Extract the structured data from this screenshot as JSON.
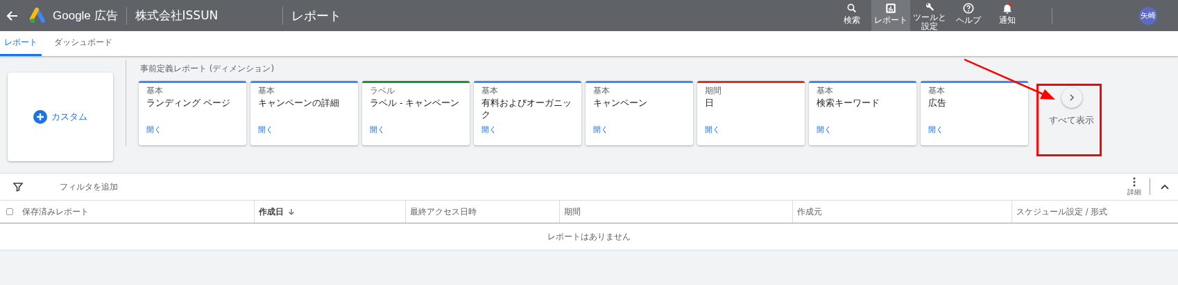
{
  "top_bar": {
    "product": "Google 広告",
    "account": "株式会社ISSUN",
    "page_title": "レポート",
    "nav": [
      {
        "label": "検索",
        "selected": false
      },
      {
        "label": "レポート",
        "selected": true
      },
      {
        "label": "ツールと設定",
        "selected": false
      },
      {
        "label": "ヘルプ",
        "selected": false
      },
      {
        "label": "通知",
        "selected": false
      }
    ],
    "avatar": "矢崎"
  },
  "tabs": [
    {
      "label": "レポート",
      "selected": true
    },
    {
      "label": "ダッシュボード",
      "selected": false
    }
  ],
  "custom_card": {
    "label": "カスタム"
  },
  "predefined": {
    "title": "事前定義レポート (ディメンション)",
    "cards": [
      {
        "category": "基本",
        "title": "ランディング ページ",
        "link": "開く",
        "color": "#4285f4"
      },
      {
        "category": "基本",
        "title": "キャンペーンの詳細",
        "link": "開く",
        "color": "#4285f4"
      },
      {
        "category": "ラベル",
        "title": "ラベル - キャンペーン",
        "link": "開く",
        "color": "#1e8e3e"
      },
      {
        "category": "基本",
        "title": "有料およびオーガニック",
        "link": "開く",
        "color": "#4285f4"
      },
      {
        "category": "基本",
        "title": "キャンペーン",
        "link": "開く",
        "color": "#4285f4"
      },
      {
        "category": "期間",
        "title": "日",
        "link": "開く",
        "color": "#d93025"
      },
      {
        "category": "基本",
        "title": "検索キーワード",
        "link": "開く",
        "color": "#4285f4"
      },
      {
        "category": "基本",
        "title": "広告",
        "link": "開く",
        "color": "#4285f4"
      }
    ],
    "show_all": "すべて表示"
  },
  "toolbar": {
    "filter": "フィルタを追加",
    "more": "詳細"
  },
  "table": {
    "select_all_checked": false,
    "columns": [
      {
        "label": "保存済みレポート",
        "sorted": false
      },
      {
        "label": "作成日",
        "sorted": true
      },
      {
        "label": "最終アクセス日時",
        "sorted": false
      },
      {
        "label": "期間",
        "sorted": false
      },
      {
        "label": "作成元",
        "sorted": false
      },
      {
        "label": "スケジュール設定 / 形式",
        "sorted": false
      }
    ],
    "empty_message": "レポートはありません"
  }
}
